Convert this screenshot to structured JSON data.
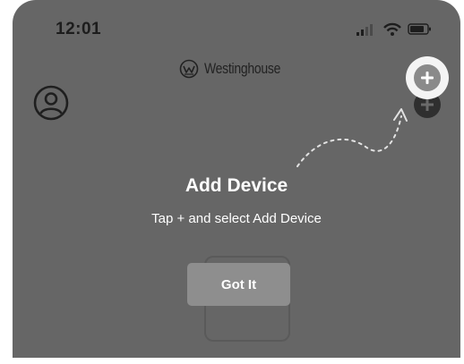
{
  "status_bar": {
    "time": "12:01",
    "icons": [
      "cellular-signal-icon",
      "wifi-icon",
      "battery-icon"
    ]
  },
  "header": {
    "brand_name": "Westinghouse",
    "brand_logo_icon": "westinghouse-w-logo-icon",
    "profile_icon": "user-profile-icon",
    "add_icon": "plus-circle-icon"
  },
  "coach_mark": {
    "title": "Add Device",
    "instruction": "Tap + and select Add Device",
    "button_label": "Got It",
    "pointer_icon": "dotted-arrow-icon"
  },
  "colors": {
    "overlay": "#666666",
    "button": "#8e8e8e",
    "text_light": "#ffffff",
    "highlight": "#f4f4f4"
  }
}
